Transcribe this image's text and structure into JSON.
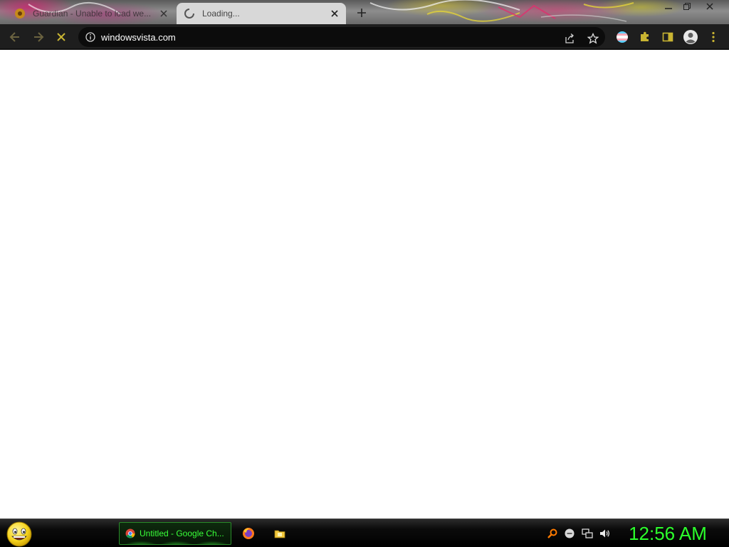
{
  "browser": {
    "tabs": [
      {
        "title": "Guardian - Unable to load we...",
        "active": false
      },
      {
        "title": "Loading...",
        "active": true
      }
    ],
    "address": "windowsvista.com"
  },
  "taskbar": {
    "task_label": "Untitled - Google Ch...",
    "clock": "12:56 AM"
  },
  "colors": {
    "toolbar_bg": "#1e1e1e",
    "toolbar_icon": "#c8b432",
    "clock_green": "#2cff2c",
    "task_label_green": "#39ff39"
  }
}
